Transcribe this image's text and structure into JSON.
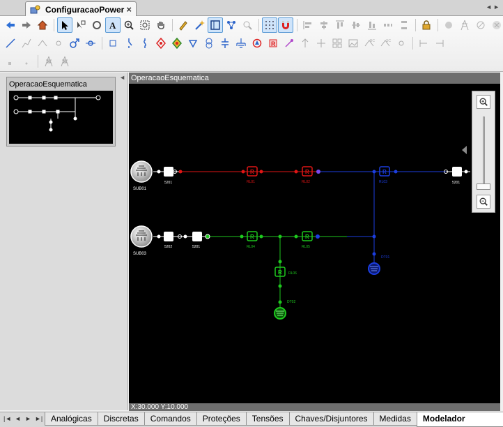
{
  "document_tab": {
    "title": "ConfiguracaoPower",
    "close": "×"
  },
  "toolbar": {
    "row1": [
      "back-icon",
      "forward-icon",
      "home-icon",
      "select-pointer-icon",
      "pan-select-icon",
      "text-tool-icon",
      "zoom-in-icon",
      "zoom-area-icon",
      "hand-pan-icon",
      "pencil-icon",
      "wand-icon",
      "layout-icon",
      "network-icon",
      "find-icon",
      "grid-toggle-icon",
      "magnet-snap-icon",
      "align-left-icon",
      "align-center-icon",
      "align-top-icon",
      "align-middle-icon",
      "align-bottom-icon",
      "distribute-icon",
      "distribute-v-icon",
      "lock-icon",
      "circle-icon",
      "tower-icon",
      "clear-icon",
      "stop-icon"
    ],
    "row2": [
      "line-icon",
      "polyline-icon",
      "bus-icon",
      "target-icon",
      "male-icon",
      "node-icon",
      "bay-icon",
      "switch-icon",
      "fuse-icon",
      "breaker-icon",
      "generator-icon",
      "load-icon",
      "transformer-icon",
      "capacitor-icon",
      "ground-icon",
      "motor-icon",
      "relay-icon",
      "sensor-icon",
      "arrow-icon",
      "cross-icon",
      "group-icon",
      "image-icon",
      "meter-icon",
      "measure-icon",
      "circle-small-icon",
      "bracket-icon",
      "bracket2-icon"
    ],
    "row3": [
      "small-square-icon",
      "small-dot-icon",
      "tower-a-icon",
      "tower-b-icon"
    ]
  },
  "left_panel": {
    "thumbnail_title": "OperacaoEsquematica"
  },
  "diagram": {
    "header": "OperacaoEsquematica",
    "status": "X:30.000 Y:10.000",
    "colors": {
      "red": "#e01515",
      "blue": "#1c3ee0",
      "green": "#1ec81e",
      "white": "#ffffff"
    },
    "labels": {
      "sub01": "SUB01",
      "sub03": "SUB03",
      "s201_a": "5201",
      "rl01": "RL01",
      "rl02": "RL02",
      "rl03": "RL03",
      "s201_b": "5201",
      "s202": "5202",
      "s201_c": "5201",
      "rl04": "RL04",
      "rl05": "RL05",
      "dt01": "DT01",
      "rl06": "RL06",
      "dt02": "DT02"
    }
  },
  "sheet_tabs": {
    "nav": [
      "|◄",
      "◄",
      "►",
      "►|"
    ],
    "tabs": [
      "Analógicas",
      "Discretas",
      "Comandos",
      "Proteções",
      "Tensões",
      "Chaves/Disjuntores",
      "Medidas",
      "Modelador Elétrico"
    ],
    "active": "Modelador Elétrico"
  }
}
